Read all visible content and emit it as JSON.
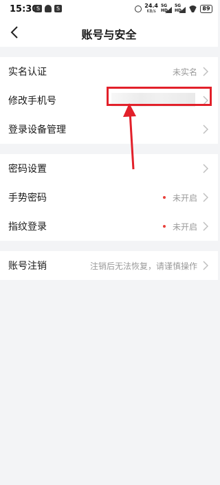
{
  "status_bar": {
    "time": "15:30",
    "left_badge_1": "Ꭶ",
    "left_badge_2": "Ꭶ",
    "net_speed": "24.4",
    "net_speed_unit": "KB/s",
    "signal_1": "5G HD",
    "signal_2": "5G HD",
    "battery": "89"
  },
  "nav": {
    "title": "账号与安全",
    "back_icon": "chevron-left-icon"
  },
  "group1": [
    {
      "label": "实名认证",
      "value": "未实名"
    },
    {
      "label": "修改手机号",
      "value": ""
    },
    {
      "label": "登录设备管理",
      "value": ""
    }
  ],
  "group2": [
    {
      "label": "密码设置",
      "value": ""
    },
    {
      "label": "手势密码",
      "value": "未开启"
    },
    {
      "label": "指纹登录",
      "value": "未开启"
    }
  ],
  "group3": [
    {
      "label": "账号注销",
      "value": "注销后无法恢复，请谨慎操作"
    }
  ],
  "colors": {
    "background": "#f3f4f6",
    "accent_red": "#e2202a",
    "status_dot": "#e8403a"
  }
}
